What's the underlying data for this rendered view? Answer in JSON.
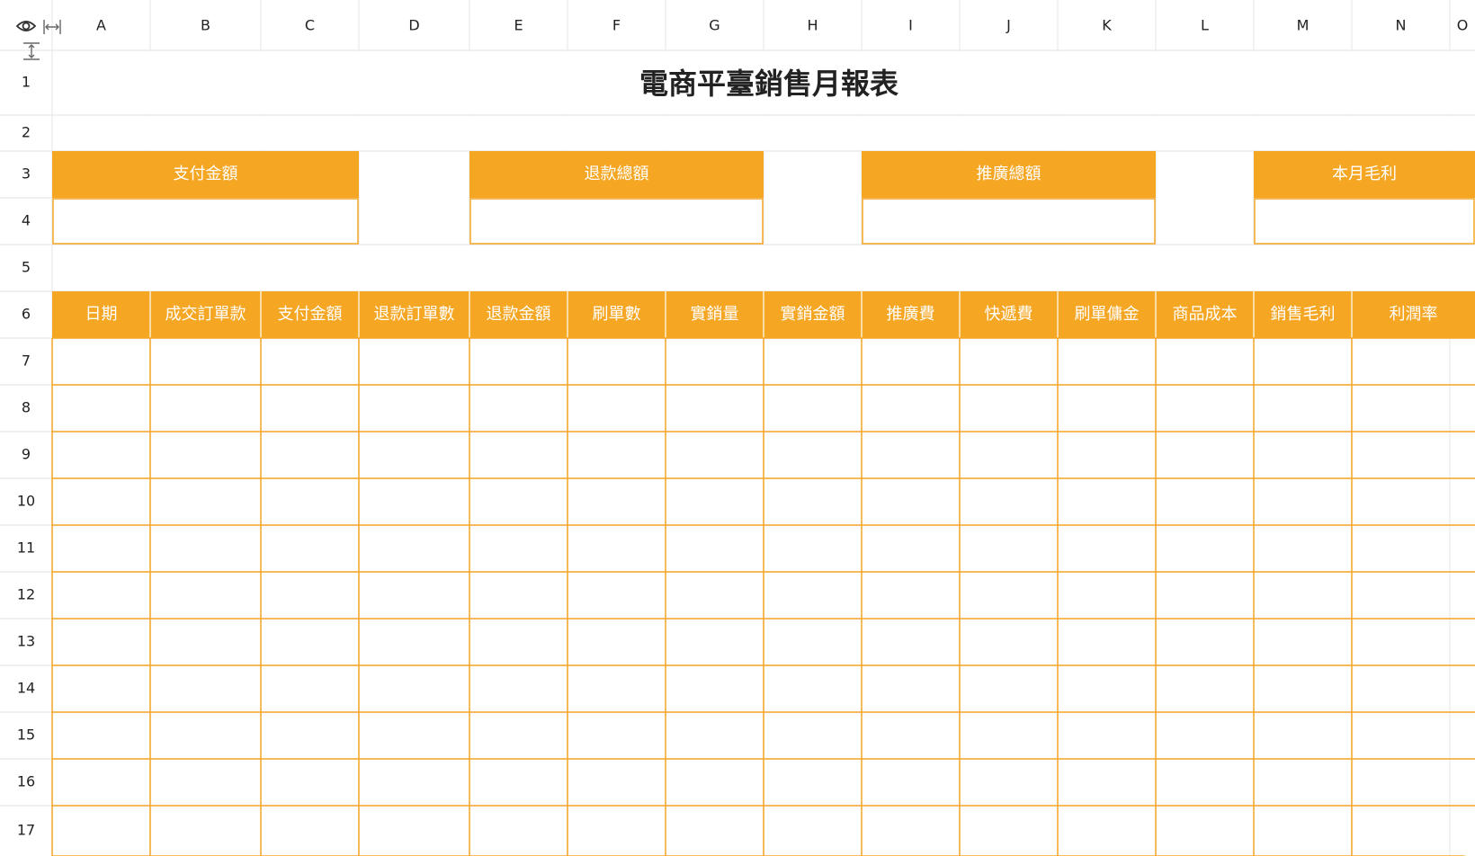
{
  "corner": {
    "toggle_visibility": "eye-icon",
    "resize_columns": "column-resize-icon",
    "resize_rows": "row-resize-icon"
  },
  "columns": [
    "A",
    "B",
    "C",
    "D",
    "E",
    "F",
    "G",
    "H",
    "I",
    "J",
    "K",
    "L",
    "M",
    "N",
    "O"
  ],
  "rows": [
    "1",
    "2",
    "3",
    "4",
    "5",
    "6",
    "7",
    "8",
    "9",
    "10",
    "11",
    "12",
    "13",
    "14",
    "15",
    "16",
    "17"
  ],
  "sheet": {
    "title": "電商平臺銷售月報表",
    "summary_labels": [
      "支付金額",
      "退款總額",
      "推廣總額",
      "本月毛利"
    ],
    "summary_values": [
      "",
      "",
      "",
      ""
    ],
    "table_headers": [
      "日期",
      "成交訂單款",
      "支付金額",
      "退款訂單數",
      "退款金額",
      "刷單數",
      "實銷量",
      "實銷金額",
      "推廣費",
      "快遞費",
      "刷單傭金",
      "商品成本",
      "銷售毛利",
      "利潤率"
    ]
  },
  "colors": {
    "accent": "#F5A623",
    "grid_border": "#E8E8E8",
    "header_text": "#ffffff"
  }
}
